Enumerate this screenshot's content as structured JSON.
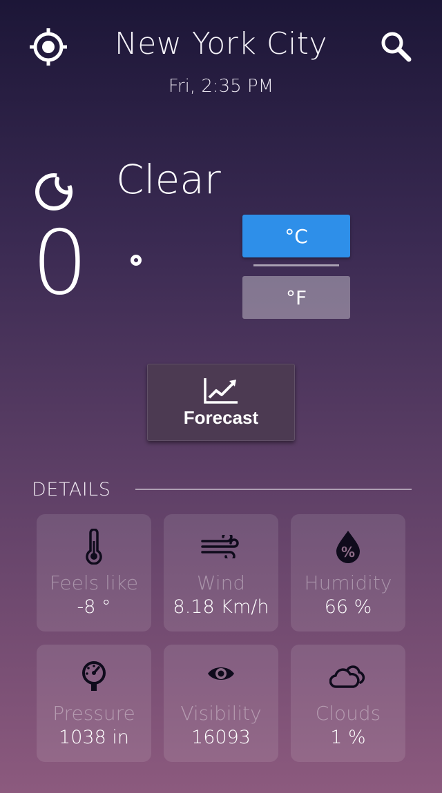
{
  "header": {
    "city": "New York City",
    "datetime": "Fri, 2:35 PM",
    "locate_icon": "crosshair-icon",
    "search_icon": "search-icon"
  },
  "current": {
    "condition": "Clear",
    "condition_icon": "moon-icon",
    "temperature": "0",
    "units": {
      "celsius": "°C",
      "fahrenheit": "°F",
      "selected": "celsius"
    }
  },
  "forecast": {
    "label": "Forecast",
    "icon": "trend-chart-icon"
  },
  "details": {
    "heading": "DETAILS",
    "items": [
      {
        "label": "Feels like",
        "value": "-8 °",
        "icon": "thermometer-icon"
      },
      {
        "label": "Wind",
        "value": "8.18 Km/h",
        "icon": "wind-icon"
      },
      {
        "label": "Humidity",
        "value": "66 %",
        "icon": "humidity-drop-icon"
      },
      {
        "label": "Pressure",
        "value": "1038 in",
        "icon": "pressure-gauge-icon"
      },
      {
        "label": "Visibility",
        "value": "16093",
        "icon": "eye-icon"
      },
      {
        "label": "Clouds",
        "value": "1 %",
        "icon": "cloud-icon"
      }
    ]
  },
  "colors": {
    "accent": "#2e8fe9",
    "card_bg": "rgba(255,255,255,0.10)",
    "icon_dark": "#0f0b1c"
  }
}
